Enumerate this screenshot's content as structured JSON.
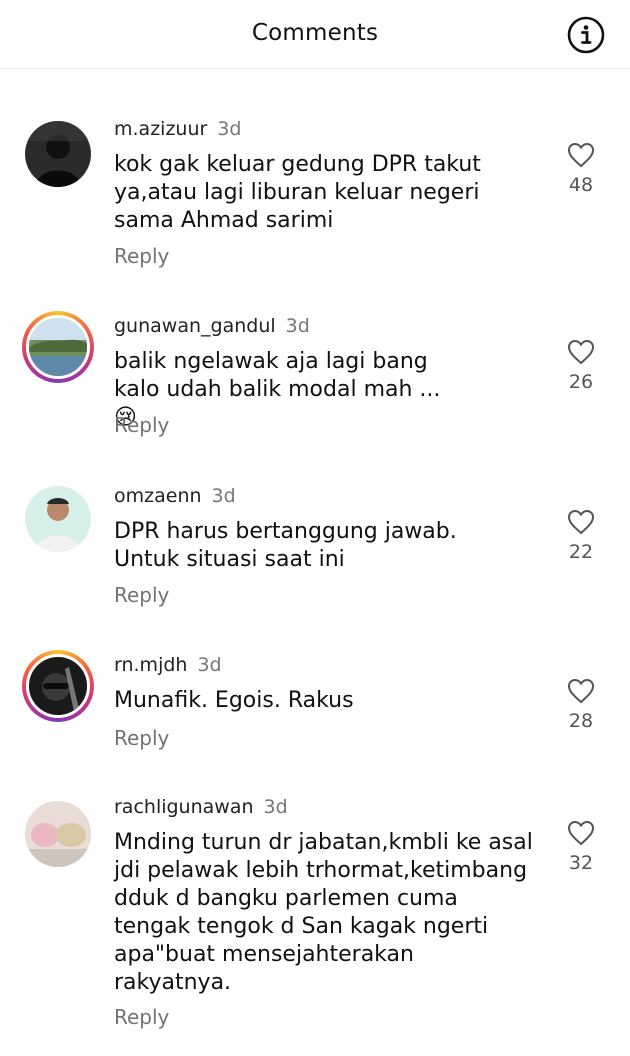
{
  "header": {
    "title": "Comments",
    "info_icon": "info-icon"
  },
  "comments": [
    {
      "username": "m.azizuur",
      "time": "3d",
      "text": "kok gak keluar gedung DPR takut ya,atau lagi liburan keluar negeri sama Ahmad sarimi",
      "reply": "Reply",
      "likes": "48",
      "avatar_ring": false
    },
    {
      "username": "gunawan_gandul",
      "time": "3d",
      "text": "balik ngelawak aja lagi bang kalo udah balik modal mah ... 😢",
      "reply": "Reply",
      "likes": "26",
      "avatar_ring": true
    },
    {
      "username": "omzaenn",
      "time": "3d",
      "text": "DPR harus bertanggung jawab. Untuk situasi saat ini",
      "reply": "Reply",
      "likes": "22",
      "avatar_ring": false
    },
    {
      "username": "rn.mjdh",
      "time": "3d",
      "text": "Munafik. Egois. Rakus",
      "reply": "Reply",
      "likes": "28",
      "avatar_ring": true
    },
    {
      "username": "rachligunawan",
      "time": "3d",
      "text": "Mnding turun dr jabatan,kmbli ke asal jdi pelawak lebih trhormat,ketimbang dduk d bangku parlemen cuma tengak tengok d San kagak ngerti apa\"buat mensejahterakan rakyatnya.",
      "reply": "Reply",
      "likes": "32",
      "avatar_ring": false
    }
  ],
  "colors": {
    "reply": "#737373",
    "time": "#777777",
    "text": "#111111"
  }
}
